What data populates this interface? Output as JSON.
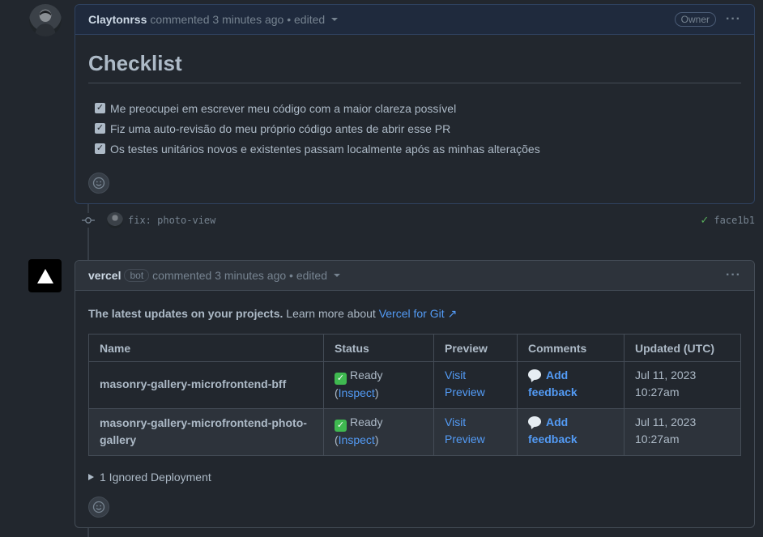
{
  "comment1": {
    "author": "Claytonrss",
    "meta": "commented 3 minutes ago • edited",
    "badge": "Owner",
    "heading": "Checklist",
    "tasks": [
      "Me preocupei em escrever meu código com a maior clareza possível",
      "Fiz uma auto-revisão do meu próprio código antes de abrir esse PR",
      "Os testes unitários novos e existentes passam localmente após as minhas alterações"
    ]
  },
  "commit": {
    "message": "fix: photo-view",
    "sha": "face1b1"
  },
  "comment2": {
    "author": "vercel",
    "badge": "bot",
    "meta": "commented 3 minutes ago • edited",
    "intro_bold": "The latest updates on your projects.",
    "intro_text": "Learn more about",
    "intro_link": "Vercel for Git ↗",
    "table": {
      "headers": [
        "Name",
        "Status",
        "Preview",
        "Comments",
        "Updated (UTC)"
      ],
      "rows": [
        {
          "name": "masonry-gallery-microfrontend-bff",
          "status": "Ready",
          "inspect": "Inspect",
          "preview": "Visit Preview",
          "comments": "Add feedback",
          "updated": "Jul 11, 2023 10:27am"
        },
        {
          "name": "masonry-gallery-microfrontend-photo-gallery",
          "status": "Ready",
          "inspect": "Inspect",
          "preview": "Visit Preview",
          "comments": "Add feedback",
          "updated": "Jul 11, 2023 10:27am"
        }
      ]
    },
    "ignored": "1 Ignored Deployment"
  },
  "colors": {
    "accent": "#539bf5",
    "success": "#57ab5a",
    "background": "#22272e"
  }
}
